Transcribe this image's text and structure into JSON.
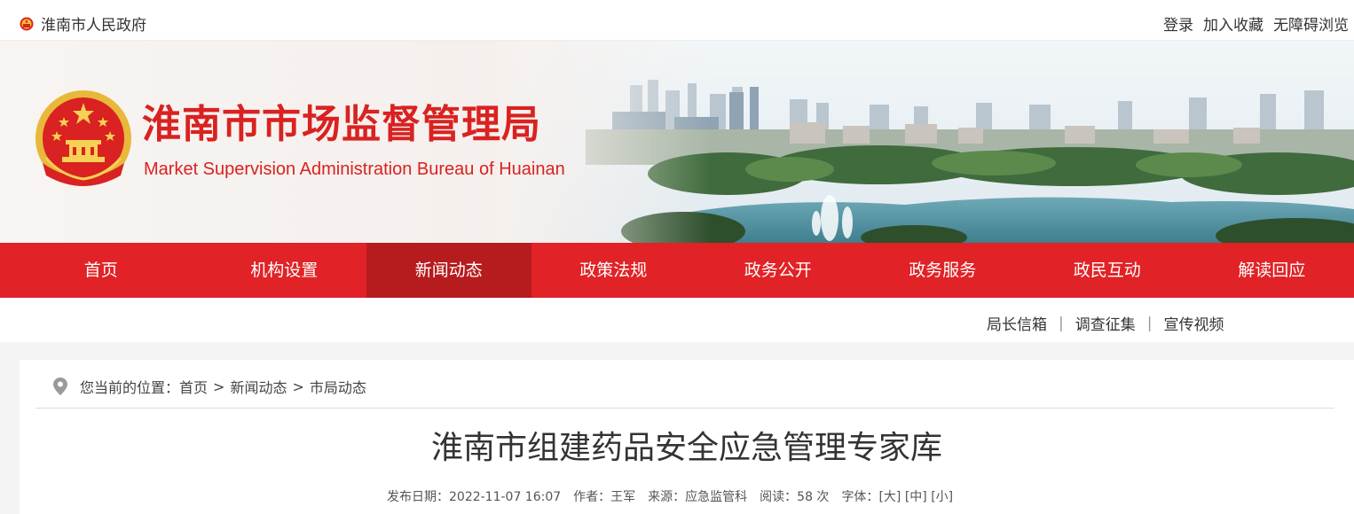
{
  "topbar": {
    "gov_name": "淮南市人民政府",
    "links": [
      "登录",
      "加入收藏",
      "无障碍浏览"
    ]
  },
  "banner": {
    "cn_title": "淮南市市场监督管理局",
    "en_title": "Market Supervision Administration Bureau of Huainan"
  },
  "nav": {
    "items": [
      "首页",
      "机构设置",
      "新闻动态",
      "政策法规",
      "政务公开",
      "政务服务",
      "政民互动",
      "解读回应"
    ],
    "active": "新闻动态"
  },
  "sublinks": [
    "局长信箱",
    "调查征集",
    "宣传视频"
  ],
  "breadcrumb": {
    "prefix": "您当前的位置：",
    "home": "首页",
    "sep": ">",
    "level1": "新闻动态",
    "level2": "市局动态"
  },
  "article": {
    "title": "淮南市组建药品安全应急管理专家库",
    "publish_date": "发布日期：2022-11-07 16:07",
    "author": "作者：王军",
    "source": "来源：应急监管科",
    "reads": "阅读：58 次",
    "font_label": "字体：",
    "font_large": "[大]",
    "font_medium": "[中]",
    "font_small": "[小]"
  },
  "colors": {
    "brand_red": "#e12226",
    "active_red": "#b61b1e",
    "title_red": "#d92221"
  }
}
